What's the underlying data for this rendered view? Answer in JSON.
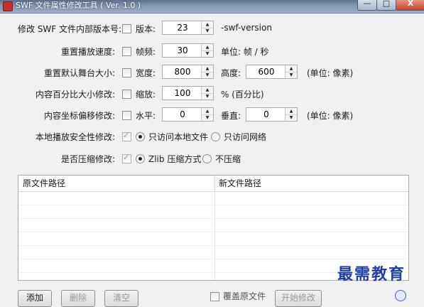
{
  "window": {
    "title": "SWF 文件属性修改工具 ( Ver. 1.0 )",
    "min": "—",
    "max": "□",
    "close": "X"
  },
  "rows": {
    "version": {
      "label": "修改 SWF 文件内部版本号:",
      "field_label": "版本:",
      "value": "23",
      "suffix": "-swf-version"
    },
    "fps": {
      "label": "重置播放速度:",
      "field_label": "帧频:",
      "value": "30",
      "suffix": "单位: 帧 / 秒"
    },
    "stage": {
      "label": "重置默认舞台大小:",
      "width_label": "宽度:",
      "width": "800",
      "height_label": "高度:",
      "height": "600",
      "unit": "(单位: 像素)"
    },
    "scale": {
      "label": "内容百分比大小修改:",
      "field_label": "缩放:",
      "value": "100",
      "unit": "% (百分比)"
    },
    "offset": {
      "label": "内容坐标偏移修改:",
      "h_label": "水平:",
      "h_value": "0",
      "v_label": "垂直:",
      "v_value": "0",
      "unit": "(单位: 像素)"
    },
    "security": {
      "label": "本地播放安全性修改:",
      "opt1": "只访问本地文件",
      "opt2": "只访问网络"
    },
    "compress": {
      "label": "是否压缩修改:",
      "opt1": "Zlib 压缩方式",
      "opt2": "不压缩"
    }
  },
  "table": {
    "col1": "原文件路径",
    "col2": "新文件路径"
  },
  "buttons": {
    "b1": "添加",
    "b2": "删除",
    "b3": "清空",
    "b4": "开始修改"
  },
  "footer": {
    "check_label": "覆盖原文件"
  },
  "watermark": "最需教育"
}
